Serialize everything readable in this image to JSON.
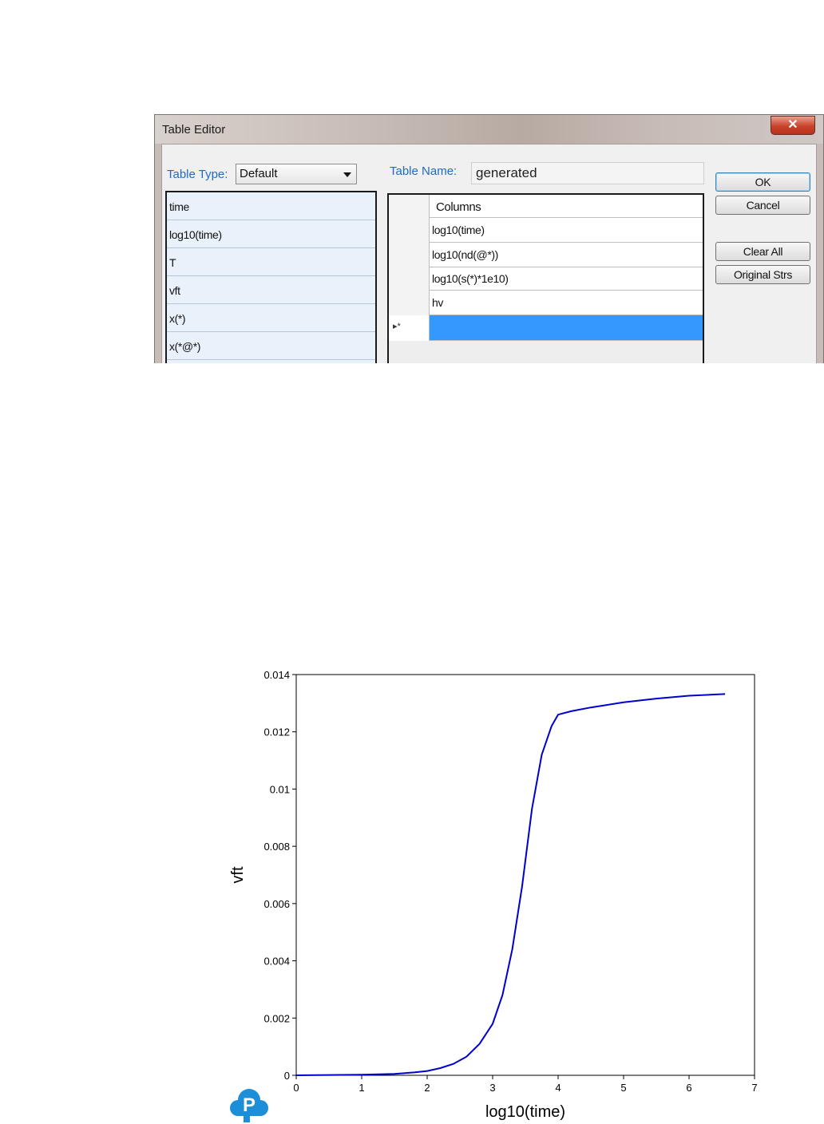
{
  "dialog": {
    "title": "Table Editor",
    "close_glyph": "✕",
    "table_type_label": "Table Type:",
    "table_type_value": "Default",
    "table_name_label": "Table Name:",
    "table_name_value": "generated",
    "available_items": [
      "time",
      "log10(time)",
      "T",
      "vft",
      "x(*)",
      "x(*@*)"
    ],
    "columns_header": "Columns",
    "columns": [
      "log10(time)",
      "log10(nd(@*))",
      "log10(s(*)*1e10)",
      "hv"
    ],
    "new_row_marker": "▸*",
    "buttons": {
      "ok": "OK",
      "cancel": "Cancel",
      "clear_all": "Clear All",
      "original_strs": "Original Strs"
    },
    "colors": {
      "selection": "#3399ff",
      "label_blue": "#1f6bbf",
      "close_red": "#c9432b"
    }
  },
  "chart_data": {
    "type": "line",
    "title": "",
    "xlabel": "log10(time)",
    "ylabel": "vft",
    "xlim": [
      0,
      7
    ],
    "ylim": [
      0,
      0.014
    ],
    "xticks": [
      "0",
      "1",
      "2",
      "3",
      "4",
      "5",
      "6",
      "7"
    ],
    "yticks": [
      "0",
      "0.002",
      "0.004",
      "0.006",
      "0.008",
      "0.01",
      "0.012",
      "0.014"
    ],
    "grid": false,
    "line_color": "#0000cc",
    "series": [
      {
        "x": [
          0,
          0.5,
          1.0,
          1.5,
          1.8,
          2.0,
          2.2,
          2.4,
          2.6,
          2.8,
          3.0,
          3.15,
          3.3,
          3.45,
          3.6,
          3.75,
          3.9,
          4.0,
          4.2,
          4.5,
          5.0,
          5.5,
          6.0,
          6.55
        ],
        "y": [
          0,
          1e-05,
          2e-05,
          5e-05,
          0.0001,
          0.00015,
          0.00025,
          0.0004,
          0.00065,
          0.0011,
          0.0018,
          0.0028,
          0.0044,
          0.0066,
          0.0093,
          0.0112,
          0.0122,
          0.0126,
          0.01272,
          0.01285,
          0.01303,
          0.01316,
          0.01326,
          0.01332
        ]
      }
    ]
  },
  "logo": {
    "icon": "cloud-p-logo",
    "letter": "P",
    "color": "#1d8fd8"
  }
}
